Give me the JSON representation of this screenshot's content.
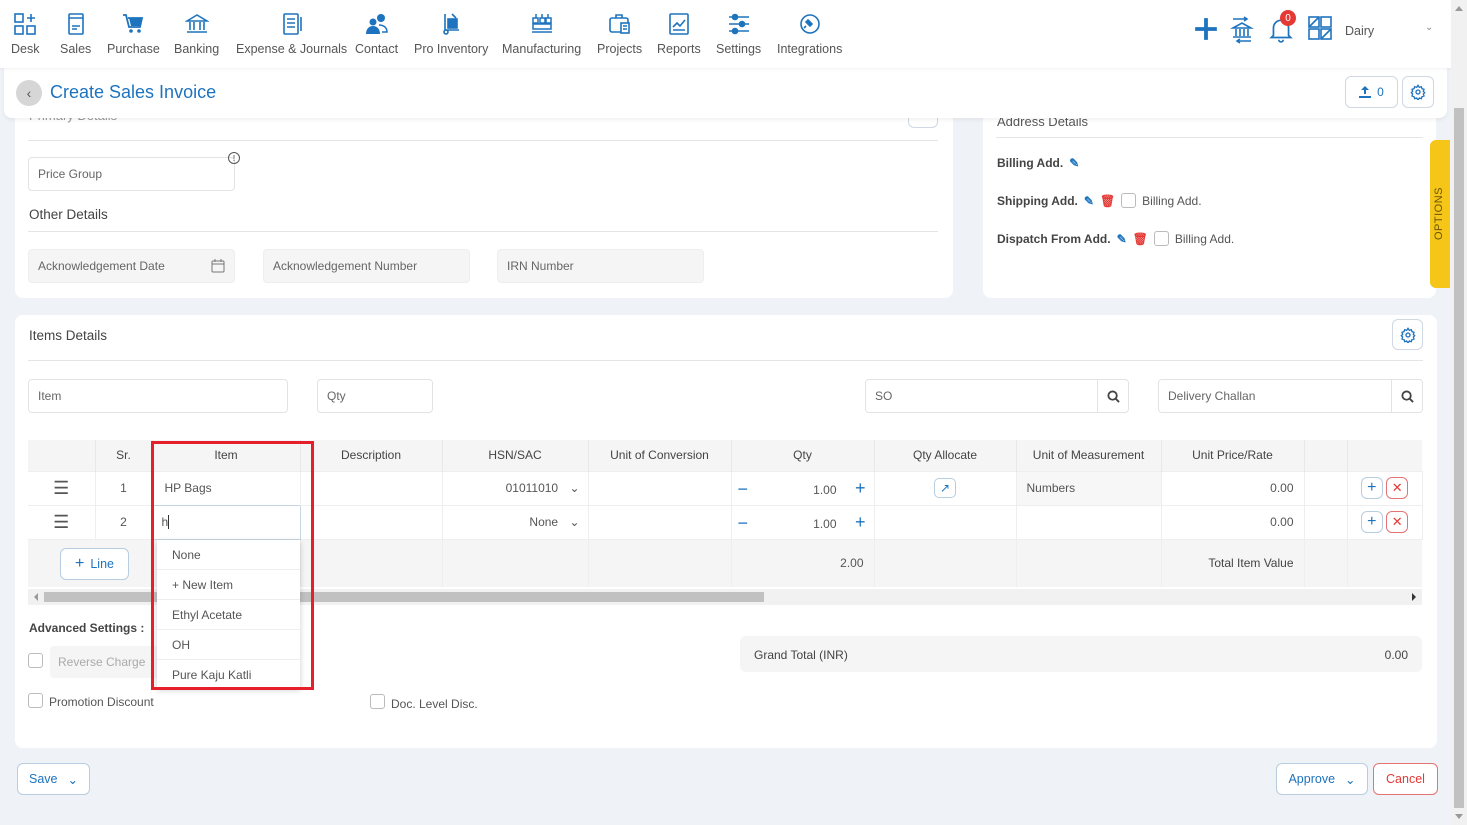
{
  "nav": {
    "items": [
      {
        "label": "Desk",
        "icon": "desk-icon"
      },
      {
        "label": "Sales",
        "icon": "sales-icon"
      },
      {
        "label": "Purchase",
        "icon": "cart-icon"
      },
      {
        "label": "Banking",
        "icon": "bank-icon"
      },
      {
        "label": "Expense & Journals",
        "icon": "journal-icon"
      },
      {
        "label": "Contact",
        "icon": "contact-icon"
      },
      {
        "label": "Pro Inventory",
        "icon": "inventory-icon"
      },
      {
        "label": "Manufacturing",
        "icon": "factory-icon"
      },
      {
        "label": "Projects",
        "icon": "briefcase-icon"
      },
      {
        "label": "Reports",
        "icon": "chart-icon"
      },
      {
        "label": "Settings",
        "icon": "sliders-icon"
      },
      {
        "label": "Integrations",
        "icon": "plug-icon"
      }
    ],
    "notification_count": "0",
    "company": "Dairy"
  },
  "header": {
    "title": "Create Sales Invoice",
    "upload_count": "0"
  },
  "primary": {
    "section_title": "Primary Details",
    "price_group_placeholder": "Price Group"
  },
  "other": {
    "section_title": "Other Details",
    "ack_date_placeholder": "Acknowledgement Date",
    "ack_number_placeholder": "Acknowledgement Number",
    "irn_placeholder": "IRN Number"
  },
  "address": {
    "section_title": "Address Details",
    "billing": "Billing Add.",
    "shipping": "Shipping Add.",
    "dispatch": "Dispatch From Add.",
    "same_as_billing": "Billing Add."
  },
  "options_tab": "OPTIONS",
  "items": {
    "section_title": "Items Details",
    "item_placeholder": "Item",
    "qty_placeholder": "Qty",
    "so_placeholder": "SO",
    "dc_placeholder": "Delivery Challan",
    "columns": [
      "",
      "Sr.",
      "Item",
      "Description",
      "HSN/SAC",
      "Unit of Conversion",
      "Qty",
      "Qty Allocate",
      "Unit of Measurement",
      "Unit Price/Rate",
      "",
      ""
    ],
    "rows": [
      {
        "sr": "1",
        "item": "HP Bags",
        "description": "",
        "hsn": "01011010",
        "uoc": "",
        "qty": "1.00",
        "uom": "Numbers",
        "rate": "0.00"
      },
      {
        "sr": "2",
        "item": "h",
        "description": "",
        "hsn": "None",
        "uoc": "",
        "qty": "1.00",
        "uom": "",
        "rate": "0.00"
      }
    ],
    "add_line": "Line",
    "total_qty": "2.00",
    "total_label": "Total Item Value",
    "dropdown_options": [
      "None",
      "+ New Item",
      "Ethyl Acetate",
      "OH",
      "Pure Kaju Katli"
    ]
  },
  "advanced": {
    "title": "Advanced Settings :",
    "reverse_charge": "Reverse Charge",
    "promotion_discount": "Promotion Discount",
    "doc_level_disc": "Doc. Level Disc."
  },
  "grand_total": {
    "label": "Grand Total (INR)",
    "value": "0.00"
  },
  "footer": {
    "save": "Save",
    "approve": "Approve",
    "cancel": "Cancel"
  },
  "colors": {
    "accent": "#1e73be",
    "danger": "#e53935",
    "options": "#f5c518"
  }
}
